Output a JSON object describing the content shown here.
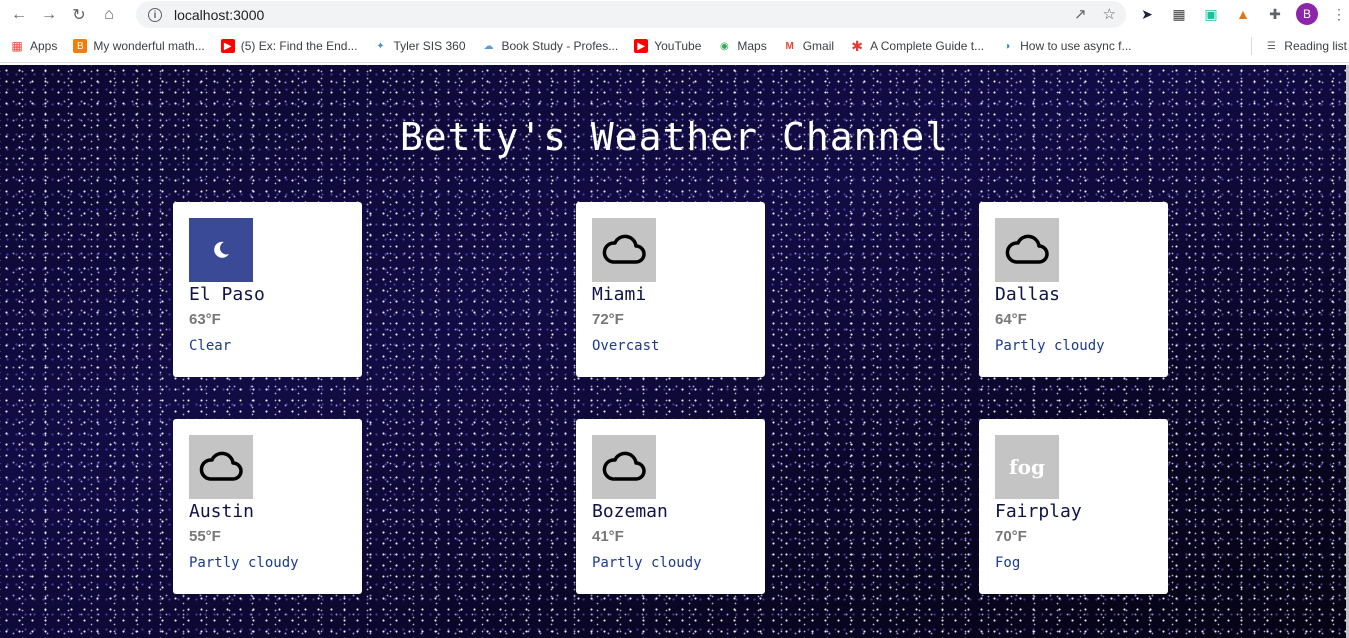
{
  "browser": {
    "url": "localhost:3000",
    "avatar_initial": "B",
    "bookmarks": [
      {
        "label": "Apps",
        "icon": "apps-grid-icon",
        "color": "#ea4335"
      },
      {
        "label": "My wonderful math...",
        "icon": "blogger-icon",
        "color": "#f57c00"
      },
      {
        "label": "(5) Ex: Find the End...",
        "icon": "youtube-icon",
        "color": "#ff0000"
      },
      {
        "label": "Tyler SIS 360",
        "icon": "tyler-icon",
        "color": "#4a90c2"
      },
      {
        "label": "Book Study - Profes...",
        "icon": "cloud-icon",
        "color": "#5b9bd5"
      },
      {
        "label": "YouTube",
        "icon": "youtube-icon",
        "color": "#ff0000"
      },
      {
        "label": "Maps",
        "icon": "maps-pin-icon",
        "color": "#34a853"
      },
      {
        "label": "Gmail",
        "icon": "gmail-icon",
        "color": "#ea4335"
      },
      {
        "label": "A Complete Guide t...",
        "icon": "asterisk-icon",
        "color": "#e53935"
      },
      {
        "label": "How to use async f...",
        "icon": "globe-icon",
        "color": "#1e88e5"
      }
    ],
    "reading_list": "Reading list"
  },
  "page": {
    "title": "Betty's Weather Channel",
    "cards": [
      {
        "city": "El Paso",
        "temp": "63°F",
        "condition": "Clear",
        "icon": "moon-icon"
      },
      {
        "city": "Miami",
        "temp": "72°F",
        "condition": "Overcast",
        "icon": "cloud-icon"
      },
      {
        "city": "Dallas",
        "temp": "64°F",
        "condition": "Partly cloudy",
        "icon": "cloud-icon"
      },
      {
        "city": "Austin",
        "temp": "55°F",
        "condition": "Partly cloudy",
        "icon": "cloud-icon"
      },
      {
        "city": "Bozeman",
        "temp": "41°F",
        "condition": "Partly cloudy",
        "icon": "cloud-icon"
      },
      {
        "city": "Fairplay",
        "temp": "70°F",
        "condition": "Fog",
        "icon": "fog-icon",
        "icon_text": "fog"
      }
    ]
  },
  "colors": {
    "night_icon_bg": "#3b4a96",
    "grey_icon_bg": "#c4c4c4",
    "condition_text": "#1a3a8c",
    "city_text": "#10124a"
  }
}
